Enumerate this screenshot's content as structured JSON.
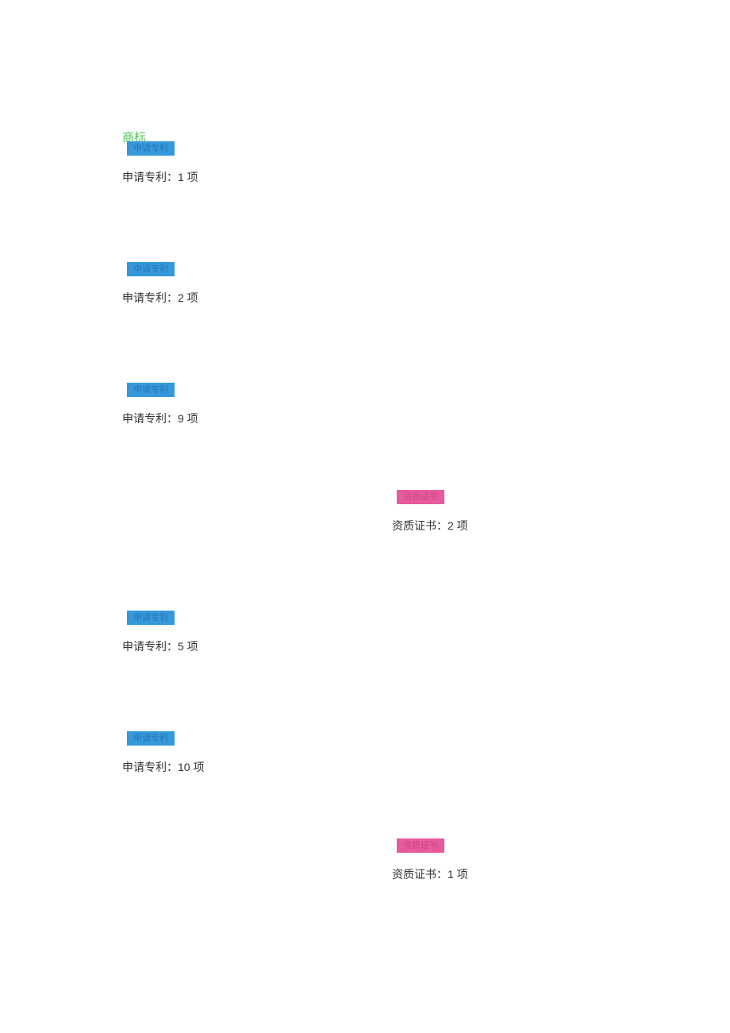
{
  "header": {
    "trademark_label": "商标"
  },
  "tags": {
    "patent": "申请专利",
    "cert": "资质证书"
  },
  "items": {
    "p1": "申请专利：1 项",
    "p2": "申请专利：2 项",
    "p3": "申请专利：9 项",
    "p4": "申请专利：5 项",
    "p5": "申请专利：10 项",
    "c1": "资质证书：2 项",
    "c2": "资质证书：1 项"
  }
}
